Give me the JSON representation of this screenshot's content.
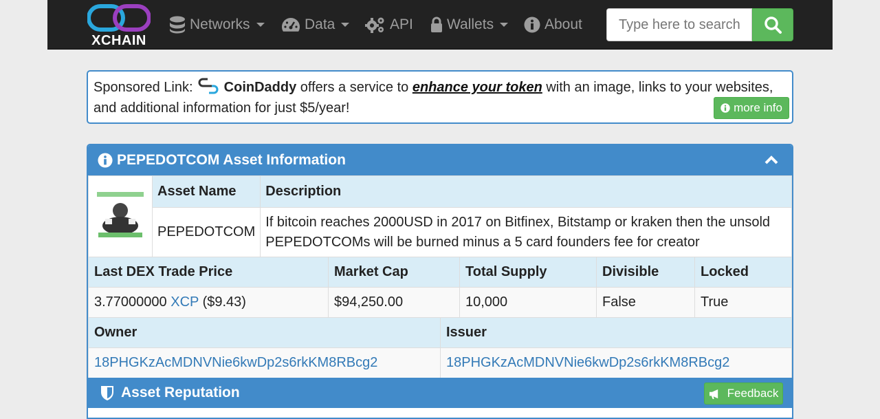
{
  "navbar": {
    "logo_text": "XCHAIN",
    "items": [
      {
        "label": "Networks",
        "icon": "database-icon",
        "dropdown": true
      },
      {
        "label": "Data",
        "icon": "dashboard-icon",
        "dropdown": true
      },
      {
        "label": "API",
        "icon": "cogs-icon",
        "dropdown": false
      },
      {
        "label": "Wallets",
        "icon": "lock-icon",
        "dropdown": true
      },
      {
        "label": "About",
        "icon": "info-circle-icon",
        "dropdown": false
      }
    ],
    "search_placeholder": "Type here to search"
  },
  "sponsor": {
    "prefix": "Sponsored Link:",
    "name": "CoinDaddy",
    "middle": "offers a service to",
    "link": "enhance your token",
    "suffix": "with an image, links to your websites, and additional information for just $5/year!",
    "more_info": "more info"
  },
  "asset": {
    "heading": "PEPEDOTCOM Asset Information",
    "name_header": "Asset Name",
    "desc_header": "Description",
    "name": "PEPEDOTCOM",
    "description": "If bitcoin reaches 2000USD in 2017 on Bitfinex, Bitstamp or kraken then the unsold PEPEDOTCOMs will be burned minus a 5 card founders fee for creator",
    "price_header": "Last DEX Trade Price",
    "mcap_header": "Market Cap",
    "supply_header": "Total Supply",
    "divisible_header": "Divisible",
    "locked_header": "Locked",
    "price": "3.77000000",
    "price_unit": "XCP",
    "price_usd": "($9.43)",
    "market_cap": "$94,250.00",
    "total_supply": "10,000",
    "divisible": "False",
    "locked": "True",
    "owner_header": "Owner",
    "issuer_header": "Issuer",
    "owner": "18PHGKzAcMDNVNie6kwDp2s6rkKM8RBcg2",
    "issuer": "18PHGKzAcMDNVNie6kwDp2s6rkKM8RBcg2"
  },
  "reputation": {
    "heading": "Asset Reputation",
    "feedback": "Feedback"
  },
  "colors": {
    "primary": "#428bca",
    "success": "#5cb85c",
    "header_bg": "#d9edf7",
    "navbar": "#222222"
  }
}
